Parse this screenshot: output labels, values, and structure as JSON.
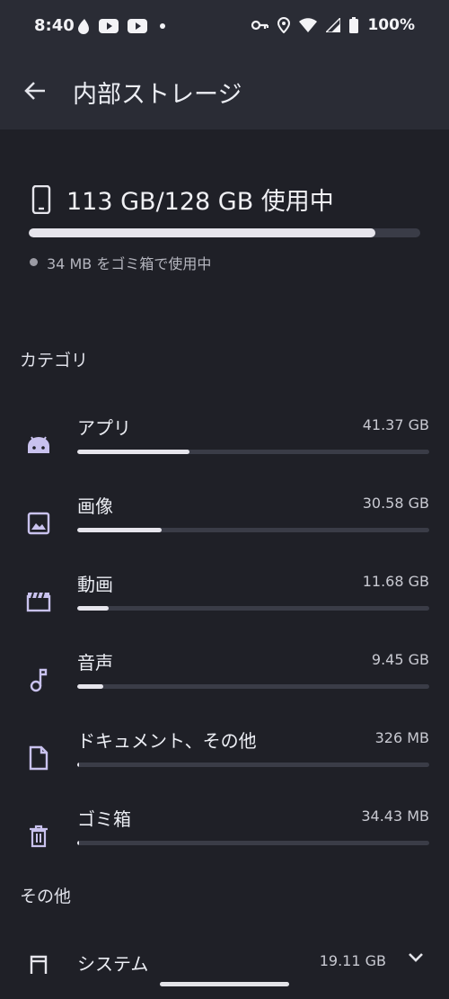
{
  "status_bar": {
    "time": "8:40",
    "left_icons": [
      "drop-icon",
      "youtube-icon",
      "youtube-icon",
      "dot-icon"
    ],
    "right_icons": [
      "key-icon",
      "location-icon",
      "wifi-icon",
      "signal-icon",
      "battery-icon"
    ],
    "battery": "100%"
  },
  "app_bar": {
    "title": "内部ストレージ"
  },
  "summary": {
    "usage": "113 GB/128 GB 使用中",
    "used_fraction": 0.885,
    "trash_note": "34 MB をゴミ箱で使用中"
  },
  "categories_title": "カテゴリ",
  "categories": [
    {
      "label": "アプリ",
      "size": "41.37 GB",
      "fraction": 0.32,
      "icon": "android-icon"
    },
    {
      "label": "画像",
      "size": "30.58 GB",
      "fraction": 0.24,
      "icon": "image-icon"
    },
    {
      "label": "動画",
      "size": "11.68 GB",
      "fraction": 0.09,
      "icon": "movie-icon"
    },
    {
      "label": "音声",
      "size": "9.45 GB",
      "fraction": 0.075,
      "icon": "music-note-icon"
    },
    {
      "label": "ドキュメント、その他",
      "size": "326 MB",
      "fraction": 0.004,
      "icon": "document-icon"
    },
    {
      "label": "ゴミ箱",
      "size": "34.43 MB",
      "fraction": 0.004,
      "icon": "trash-icon"
    }
  ],
  "other_title": "その他",
  "system": {
    "label": "システム",
    "size": "19.11 GB",
    "icon": "system-icon"
  },
  "colors": {
    "background": "#1f2027",
    "app_bar": "#2a2c35",
    "bar_track": "#3a3c47",
    "bar_fill": "#e6e5ec",
    "icon_accent": "#c9c2ee"
  }
}
